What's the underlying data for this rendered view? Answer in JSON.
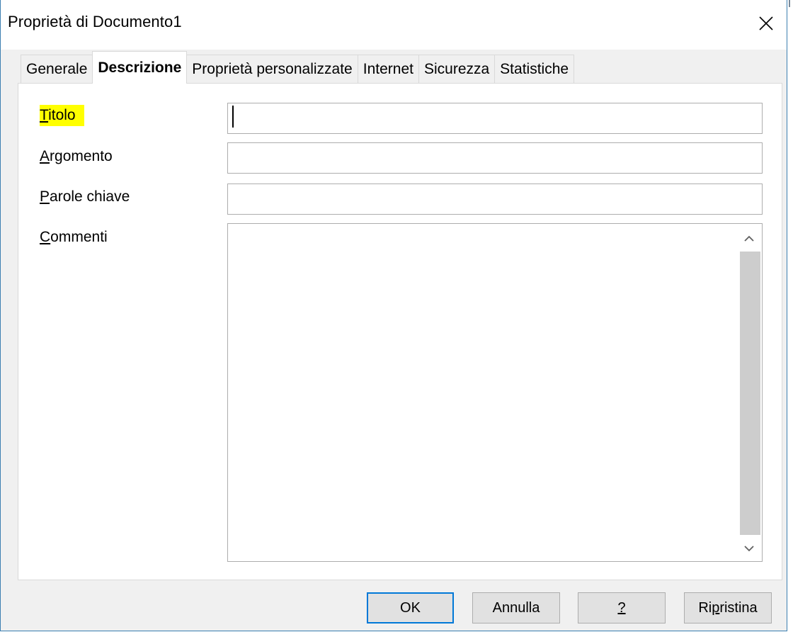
{
  "window": {
    "title": "Proprietà di Documento1",
    "close_icon": "close-icon"
  },
  "tabs": [
    {
      "label": "Generale",
      "active": false
    },
    {
      "label": "Descrizione",
      "active": true
    },
    {
      "label": "Proprietà personalizzate",
      "active": false
    },
    {
      "label": "Internet",
      "active": false
    },
    {
      "label": "Sicurezza",
      "active": false
    },
    {
      "label": "Statistiche",
      "active": false
    }
  ],
  "form": {
    "title": {
      "label_accel": "T",
      "label_rest": "itolo",
      "value": "",
      "highlight_color": "#ffff00"
    },
    "subject": {
      "label_accel": "A",
      "label_rest": "rgomento",
      "value": ""
    },
    "keywords": {
      "label_accel": "P",
      "label_rest": "arole chiave",
      "value": ""
    },
    "comments": {
      "label_accel": "C",
      "label_rest": "ommenti",
      "value": ""
    }
  },
  "buttons": {
    "ok": "OK",
    "cancel": "Annulla",
    "help": "?",
    "reset_pre": "Ri",
    "reset_accel": "p",
    "reset_post": "ristina"
  },
  "colors": {
    "accent": "#0078d7",
    "frame": "#3c7fb1"
  }
}
